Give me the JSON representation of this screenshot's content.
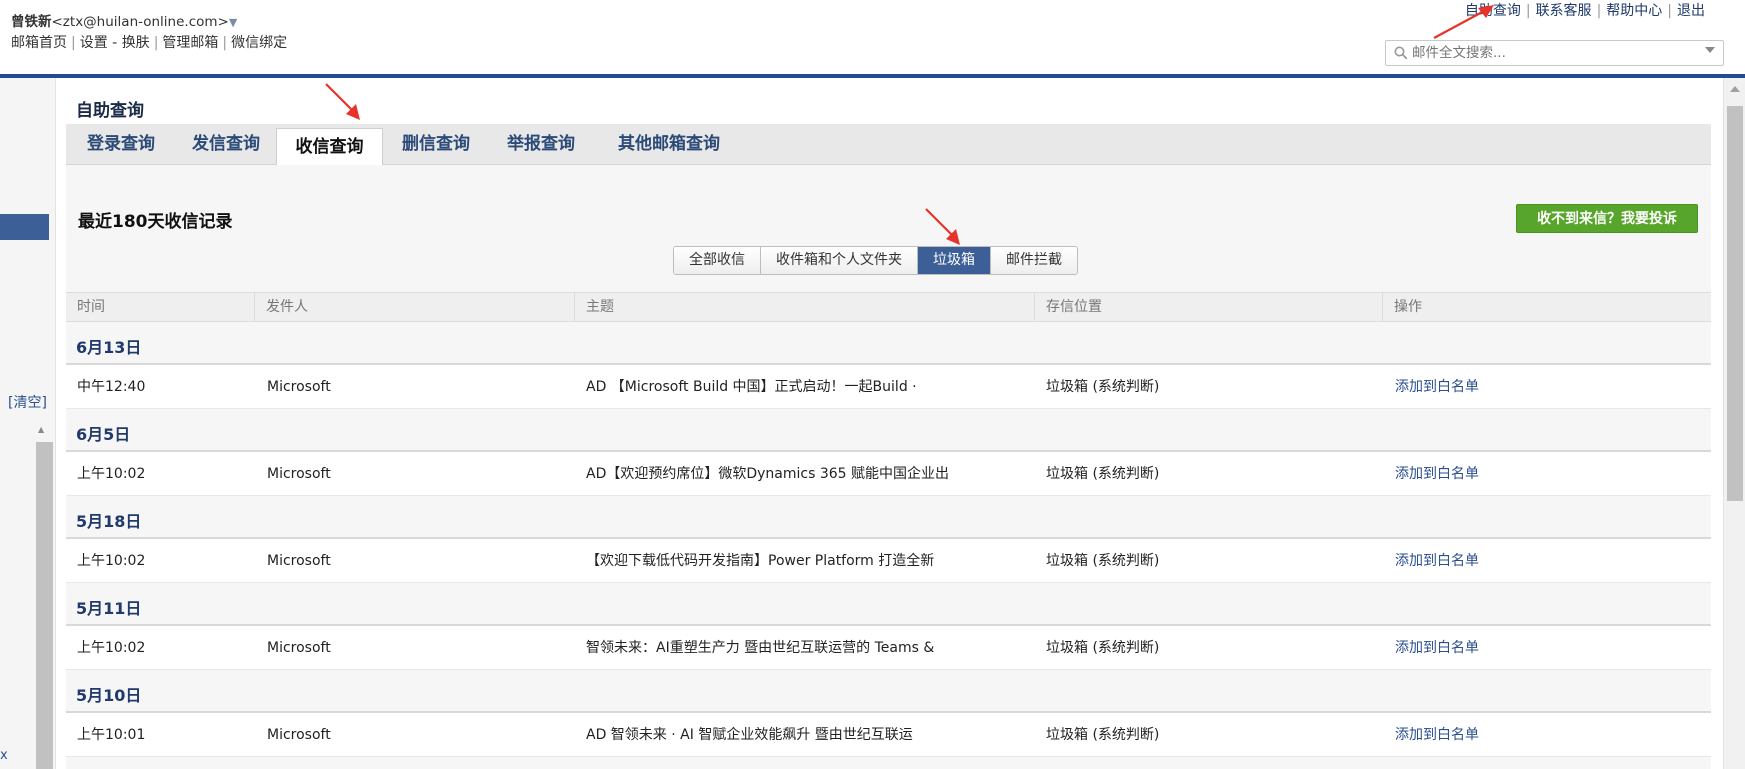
{
  "header": {
    "user_name": "曾铁新",
    "user_email": "<ztx@huilan-online.com>",
    "user_caret": "▼",
    "nav": [
      "邮箱首页",
      "设置",
      "-",
      "换肤",
      "管理邮箱",
      "微信绑定"
    ],
    "top_links": [
      "自助查询",
      "联系客服",
      "帮助中心",
      "退出"
    ],
    "search_placeholder": "邮件全文搜索..."
  },
  "sidebar": {
    "clear_label": "[清空]",
    "bottom_label": "x"
  },
  "main": {
    "page_title": "自助查询",
    "tabs": [
      "登录查询",
      "发信查询",
      "收信查询",
      "删信查询",
      "举报查询",
      "其他邮箱查询"
    ],
    "active_tab": "收信查询",
    "section_title": "最近180天收信记录",
    "complain_button": "收不到来信？我要投诉",
    "filters": [
      "全部收信",
      "收件箱和个人文件夹",
      "垃圾箱",
      "邮件拦截"
    ],
    "active_filter": "垃圾箱",
    "columns": [
      "时间",
      "发件人",
      "主题",
      "存信位置",
      "操作"
    ],
    "groups": [
      {
        "date": "6月13日",
        "rows": [
          {
            "time": "中午12:40",
            "sender": "Microsoft",
            "subject": "AD 【Microsoft Build 中国】正式启动！一起Build ·",
            "location": "垃圾箱 (系统判断)",
            "action": "添加到白名单"
          }
        ]
      },
      {
        "date": "6月5日",
        "rows": [
          {
            "time": "上午10:02",
            "sender": "Microsoft",
            "subject": "AD【欢迎预约席位】微软Dynamics 365 赋能中国企业出",
            "location": "垃圾箱 (系统判断)",
            "action": "添加到白名单"
          }
        ]
      },
      {
        "date": "5月18日",
        "rows": [
          {
            "time": "上午10:02",
            "sender": "Microsoft",
            "subject": "【欢迎下载低代码开发指南】Power Platform 打造全新",
            "location": "垃圾箱 (系统判断)",
            "action": "添加到白名单"
          }
        ]
      },
      {
        "date": "5月11日",
        "rows": [
          {
            "time": "上午10:02",
            "sender": "Microsoft",
            "subject": "智领未来：AI重塑生产力 暨由世纪互联运营的 Teams &",
            "location": "垃圾箱 (系统判断)",
            "action": "添加到白名单"
          }
        ]
      },
      {
        "date": "5月10日",
        "rows": [
          {
            "time": "上午10:01",
            "sender": "Microsoft",
            "subject": "AD 智领未来 · AI 智赋企业效能飙升 暨由世纪互联运",
            "location": "垃圾箱 (系统判断)",
            "action": "添加到白名单"
          }
        ]
      }
    ]
  },
  "colors": {
    "brand_blue": "#1f4e8c",
    "active_filter": "#3d5f97",
    "complain_green": "#57a52a",
    "annotation_red": "#e8332a"
  }
}
